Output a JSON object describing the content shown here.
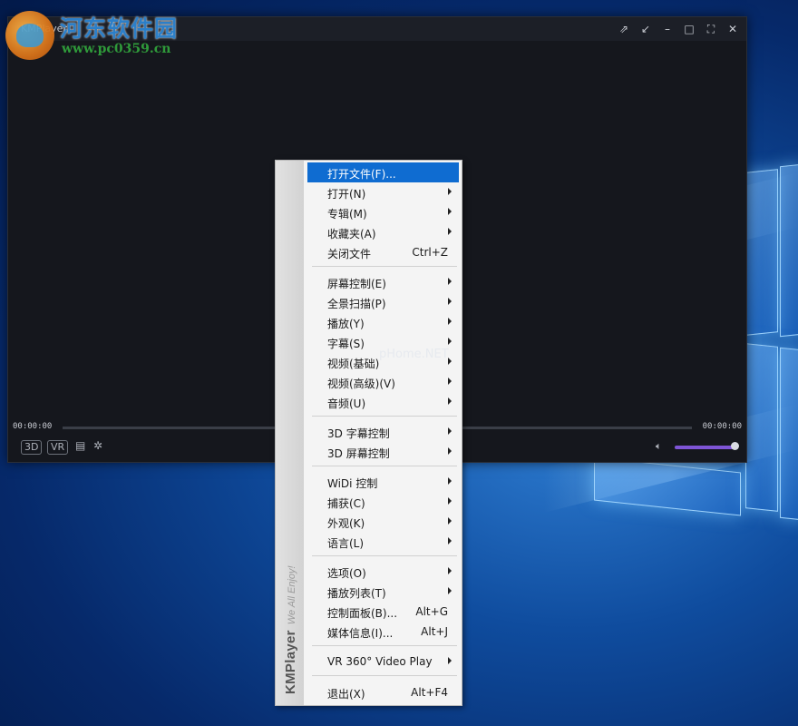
{
  "watermark": {
    "site_name": "河东软件园",
    "url": "www.pc0359.cn",
    "overlay_text": "pHome.NET"
  },
  "player": {
    "title": "KMPlayer",
    "window_controls": [
      "pin-icon",
      "restore-small-icon",
      "minimize-icon",
      "maximize-icon",
      "fullscreen-icon",
      "close-icon"
    ],
    "time_left": "00:00:00",
    "time_right": "00:00:00",
    "btn_3d": "3D",
    "btn_vr": "VR",
    "volume_level": 0.95,
    "accent_color": "#7e55d6"
  },
  "menu": {
    "brand": "KMPlayer",
    "tagline": "We All Enjoy!",
    "items": [
      {
        "label": "打开文件(F)...",
        "shortcut": "",
        "submenu": false,
        "selected": true
      },
      {
        "label": "打开(N)",
        "shortcut": "",
        "submenu": true,
        "selected": false
      },
      {
        "label": "专辑(M)",
        "shortcut": "",
        "submenu": true,
        "selected": false
      },
      {
        "label": "收藏夹(A)",
        "shortcut": "",
        "submenu": true,
        "selected": false
      },
      {
        "label": "关闭文件",
        "shortcut": "Ctrl+Z",
        "submenu": false,
        "selected": false
      },
      {
        "label": "屏幕控制(E)",
        "shortcut": "",
        "submenu": true,
        "selected": false
      },
      {
        "label": "全景扫描(P)",
        "shortcut": "",
        "submenu": true,
        "selected": false
      },
      {
        "label": "播放(Y)",
        "shortcut": "",
        "submenu": true,
        "selected": false
      },
      {
        "label": "字幕(S)",
        "shortcut": "",
        "submenu": true,
        "selected": false
      },
      {
        "label": "视频(基础)",
        "shortcut": "",
        "submenu": true,
        "selected": false
      },
      {
        "label": "视频(高级)(V)",
        "shortcut": "",
        "submenu": true,
        "selected": false
      },
      {
        "label": "音频(U)",
        "shortcut": "",
        "submenu": true,
        "selected": false
      },
      {
        "label": "3D 字幕控制",
        "shortcut": "",
        "submenu": true,
        "selected": false
      },
      {
        "label": "3D 屏幕控制",
        "shortcut": "",
        "submenu": true,
        "selected": false
      },
      {
        "label": "WiDi 控制",
        "shortcut": "",
        "submenu": true,
        "selected": false
      },
      {
        "label": "捕获(C)",
        "shortcut": "",
        "submenu": true,
        "selected": false
      },
      {
        "label": "外观(K)",
        "shortcut": "",
        "submenu": true,
        "selected": false
      },
      {
        "label": "语言(L)",
        "shortcut": "",
        "submenu": true,
        "selected": false
      },
      {
        "label": "选项(O)",
        "shortcut": "",
        "submenu": true,
        "selected": false
      },
      {
        "label": "播放列表(T)",
        "shortcut": "",
        "submenu": true,
        "selected": false
      },
      {
        "label": "控制面板(B)...",
        "shortcut": "Alt+G",
        "submenu": false,
        "selected": false
      },
      {
        "label": "媒体信息(I)...",
        "shortcut": "Alt+J",
        "submenu": false,
        "selected": false
      },
      {
        "label": "VR 360° Video Play",
        "shortcut": "",
        "submenu": true,
        "selected": false
      },
      {
        "label": "退出(X)",
        "shortcut": "Alt+F4",
        "submenu": false,
        "selected": false
      }
    ]
  }
}
